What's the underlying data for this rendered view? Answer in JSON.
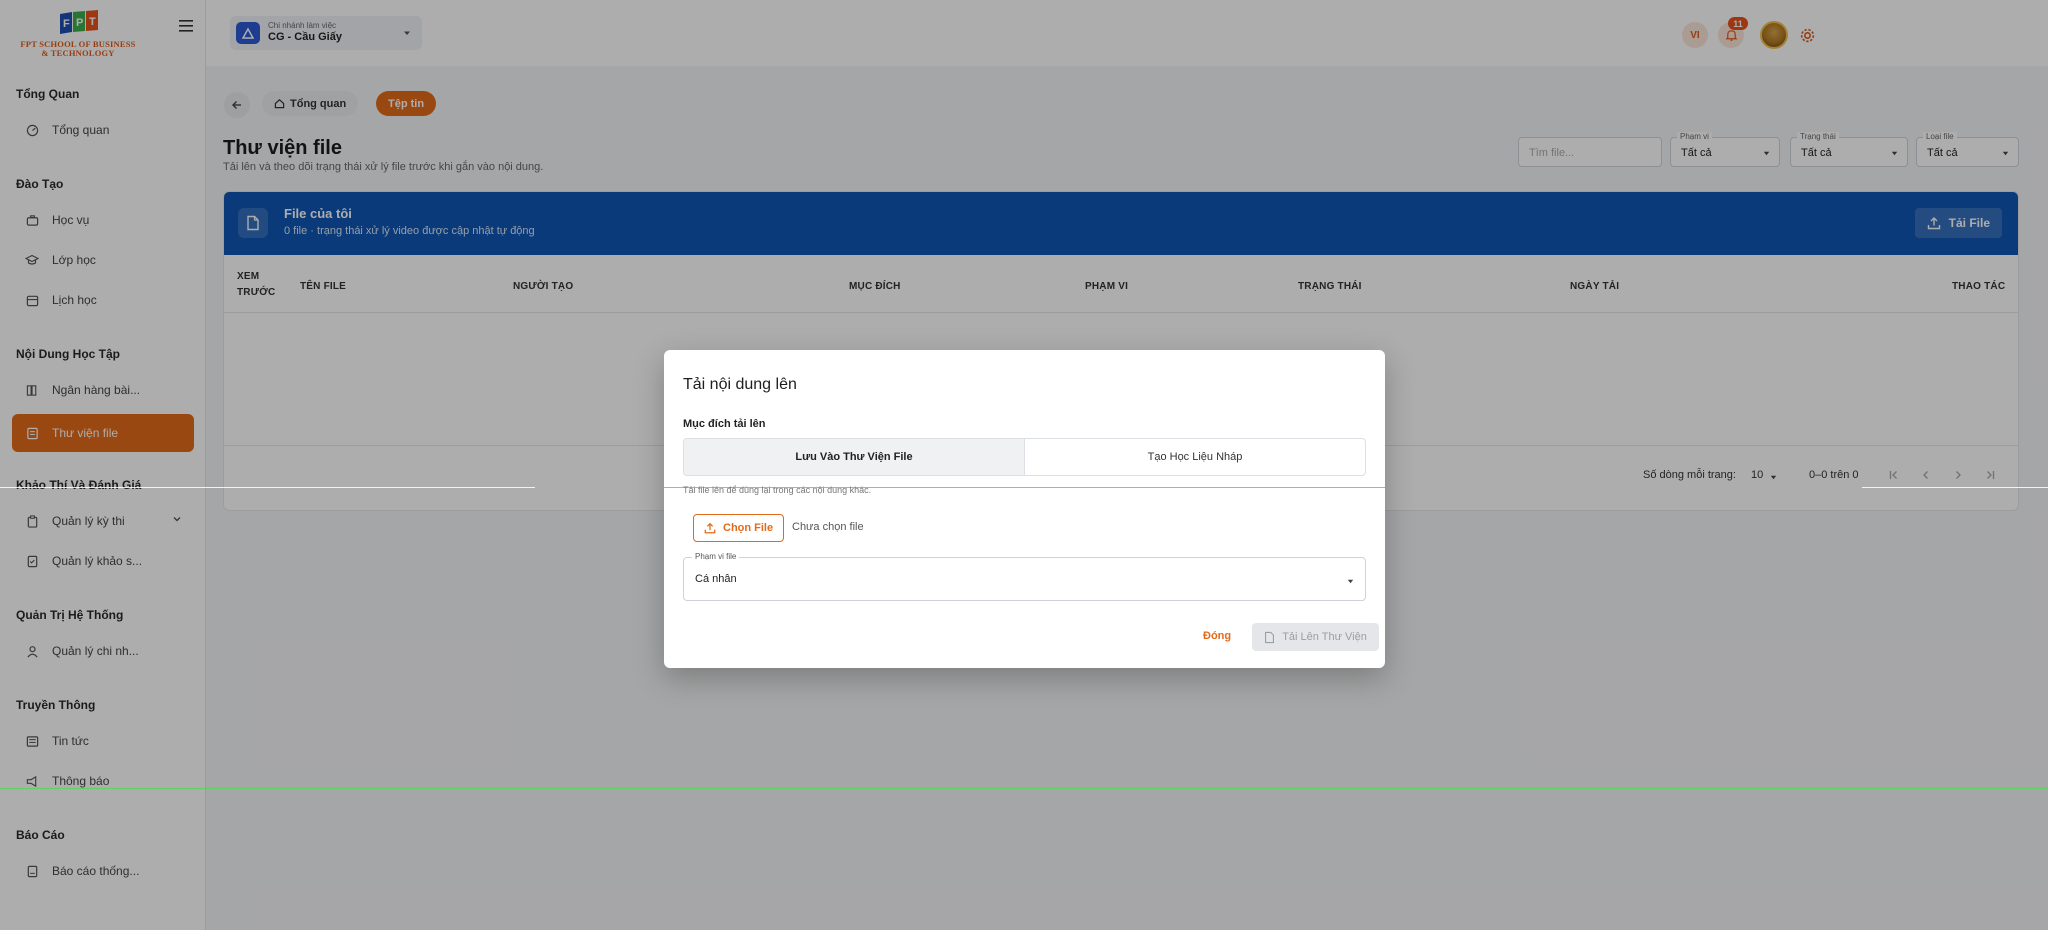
{
  "sidebar": {
    "logo_text_line1": "FPT SCHOOL OF BUSINESS",
    "logo_text_line2": "& TECHNOLOGY",
    "groups": {
      "overview": "Tổng Quan",
      "training": "Đào Tạo",
      "content": "Nội Dung Học Tập",
      "exam": "Khảo Thí Và Đánh Giá",
      "admin": "Quản Trị Hệ Thống",
      "media": "Truyền Thông",
      "report": "Báo Cáo"
    },
    "items": {
      "overview": "Tổng quan",
      "academic": "Học vụ",
      "classes": "Lớp học",
      "schedule": "Lịch học",
      "question_bank": "Ngân hàng bài...",
      "file_library": "Thư viện file",
      "exam_mgmt": "Quản lý kỳ thi",
      "survey_mgmt": "Quản lý khảo s...",
      "branch_mgmt": "Quản lý chi nh...",
      "news": "Tin tức",
      "notifications": "Thông báo",
      "stats_report": "Báo cáo thống..."
    }
  },
  "topbar": {
    "branch_label": "Chi nhánh làm việc",
    "branch_name": "CG - Cầu Giấy",
    "lang": "VI",
    "notif_count": "11"
  },
  "breadcrumb": {
    "home": "Tổng quan",
    "current": "Tệp tin"
  },
  "page": {
    "title": "Thư viện file",
    "subtitle": "Tải lên và theo dõi trạng thái xử lý file trước khi gắn vào nội dung."
  },
  "filters": {
    "search_placeholder": "Tìm file...",
    "scope_label": "Phạm vi",
    "scope_value": "Tất cả",
    "status_label": "Trạng thái",
    "status_value": "Tất cả",
    "type_label": "Loại file",
    "type_value": "Tất cả"
  },
  "files": {
    "title": "File của tôi",
    "subtitle": "0 file · trạng thái xử lý video được cập nhật tự động",
    "upload": "Tải File",
    "columns": {
      "preview_1": "XEM",
      "preview_2": "TRƯỚC",
      "name": "TÊN FILE",
      "creator": "NGƯỜI TẠO",
      "purpose": "MỤC ĐÍCH",
      "scope": "PHẠM VI",
      "status": "TRẠNG THÁI",
      "date": "NGÀY TẢI",
      "actions": "THAO TÁC"
    },
    "pagination": {
      "rows_label": "Số dòng mỗi trang:",
      "rows_value": "10",
      "range": "0–0 trên 0"
    }
  },
  "modal": {
    "title": "Tải nội dung lên",
    "purpose_label": "Mục đích tải lên",
    "option_library": "Lưu Vào Thư Viện File",
    "option_draft": "Tạo Học Liệu Nháp",
    "hint": "Tải file lên để dùng lại trong các nội dung khác.",
    "choose_file": "Chọn File",
    "no_file": "Chưa chọn file",
    "scope_label": "Phạm vi file",
    "scope_value": "Cá nhân",
    "close": "Đóng",
    "submit": "Tải Lên Thư Viện"
  },
  "colors": {
    "brand_orange": "#e26a1a",
    "header_blue": "#0f56b3",
    "branch_blue": "#2d5bd6"
  }
}
